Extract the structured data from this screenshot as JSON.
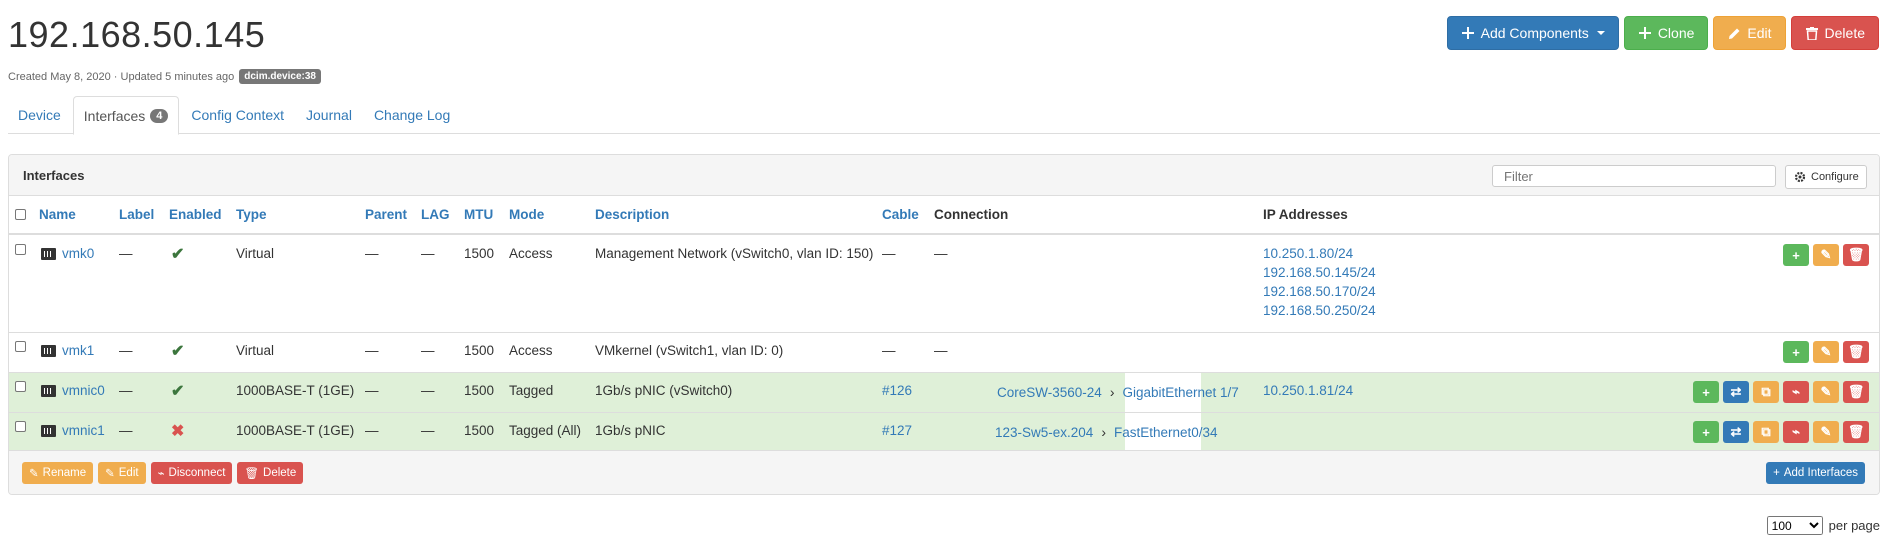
{
  "page": {
    "title": "192.168.50.145",
    "created": "Created May 8, 2020 · Updated 5 minutes ago",
    "tag": "dcim.device:38"
  },
  "actions": {
    "add_components": "Add Components",
    "clone": "Clone",
    "edit": "Edit",
    "delete": "Delete"
  },
  "tabs": [
    {
      "label": "Device"
    },
    {
      "label": "Interfaces",
      "badge": "4"
    },
    {
      "label": "Config Context"
    },
    {
      "label": "Journal"
    },
    {
      "label": "Change Log"
    }
  ],
  "panel": {
    "title": "Interfaces",
    "filter_placeholder": "Filter",
    "configure": "Configure"
  },
  "columns": {
    "name": "Name",
    "label": "Label",
    "enabled": "Enabled",
    "type": "Type",
    "parent": "Parent",
    "lag": "LAG",
    "mtu": "MTU",
    "mode": "Mode",
    "description": "Description",
    "cable": "Cable",
    "connection": "Connection",
    "ip": "IP Addresses"
  },
  "rows": [
    {
      "name": "vmk0",
      "label": "—",
      "enabled": true,
      "type": "Virtual",
      "parent": "—",
      "lag": "—",
      "mtu": "1500",
      "mode": "Access",
      "description": "Management Network (vSwitch0, vlan ID: 150)",
      "cable": "—",
      "connection": "—",
      "ips": [
        "10.250.1.80/24",
        "192.168.50.145/24",
        "192.168.50.170/24",
        "192.168.50.250/24"
      ]
    },
    {
      "name": "vmk1",
      "label": "—",
      "enabled": true,
      "type": "Virtual",
      "parent": "—",
      "lag": "—",
      "mtu": "1500",
      "mode": "Access",
      "description": "VMkernel (vSwitch1, vlan ID: 0)",
      "cable": "—",
      "connection": "—",
      "ips": []
    },
    {
      "name": "vmnic0",
      "label": "—",
      "enabled": true,
      "type": "1000BASE-T (1GE)",
      "parent": "—",
      "lag": "—",
      "mtu": "1500",
      "mode": "Tagged",
      "description": "1Gb/s pNIC (vSwitch0)",
      "cable": "#126",
      "conn_device": "CoreSW-3560-24",
      "conn_iface": "GigabitEthernet 1/7",
      "ips": [
        "10.250.1.81/24"
      ]
    },
    {
      "name": "vmnic1",
      "label": "—",
      "enabled": false,
      "type": "1000BASE-T (1GE)",
      "parent": "—",
      "lag": "—",
      "mtu": "1500",
      "mode": "Tagged (All)",
      "description": "1Gb/s pNIC",
      "cable": "#127",
      "conn_device": "123-Sw5-ex.204",
      "conn_iface": "FastEthernet0/34",
      "ips": []
    }
  ],
  "footer": {
    "rename": "Rename",
    "edit": "Edit",
    "disconnect": "Disconnect",
    "delete": "Delete",
    "add_interfaces": "Add Interfaces"
  },
  "pagination": {
    "per_page_value": "100",
    "per_page_label": "per page"
  },
  "colors": {
    "primary": "#337ab7",
    "success": "#5cb85c",
    "warning": "#f0ad4e",
    "danger": "#d9534f",
    "connected_row": "#dff0d8"
  }
}
